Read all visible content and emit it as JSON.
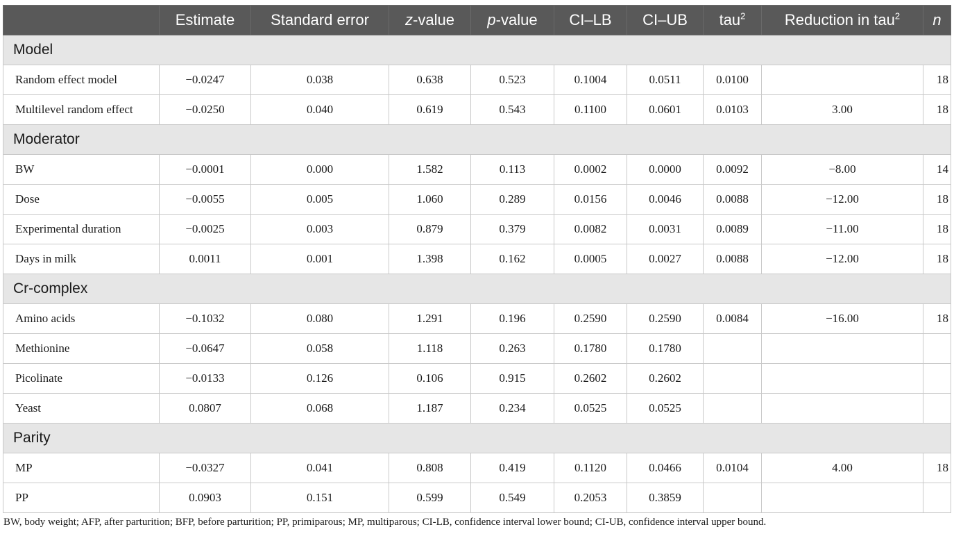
{
  "header": {
    "c1": "Estimate",
    "c2": "Standard error",
    "c3_italic": "z",
    "c3_rest": "-value",
    "c4_italic": "p",
    "c4_rest": "-value",
    "c5": "CI–LB",
    "c6": "CI–UB",
    "c7_base": "tau",
    "c7_sup": "2",
    "c8_base": "Reduction in tau",
    "c8_sup": "2",
    "c9": "n"
  },
  "sections": [
    {
      "title": "Model",
      "rows": [
        {
          "label": "Random effect model",
          "estimate": "−0.0247",
          "se": "0.038",
          "z": "0.638",
          "p": "0.523",
          "cilb": "0.1004",
          "ciub": "0.0511",
          "tau2": "0.0100",
          "reduction": "",
          "n": "18"
        },
        {
          "label": "Multilevel random effect",
          "estimate": "−0.0250",
          "se": "0.040",
          "z": "0.619",
          "p": "0.543",
          "cilb": "0.1100",
          "ciub": "0.0601",
          "tau2": "0.0103",
          "reduction": "3.00",
          "n": "18"
        }
      ]
    },
    {
      "title": "Moderator",
      "rows": [
        {
          "label": "BW",
          "estimate": "−0.0001",
          "se": "0.000",
          "z": "1.582",
          "p": "0.113",
          "cilb": "0.0002",
          "ciub": "0.0000",
          "tau2": "0.0092",
          "reduction": "−8.00",
          "n": "14"
        },
        {
          "label": "Dose",
          "estimate": "−0.0055",
          "se": "0.005",
          "z": "1.060",
          "p": "0.289",
          "cilb": "0.0156",
          "ciub": "0.0046",
          "tau2": "0.0088",
          "reduction": "−12.00",
          "n": "18"
        },
        {
          "label": "Experimental duration",
          "estimate": "−0.0025",
          "se": "0.003",
          "z": "0.879",
          "p": "0.379",
          "cilb": "0.0082",
          "ciub": "0.0031",
          "tau2": "0.0089",
          "reduction": "−11.00",
          "n": "18"
        },
        {
          "label": "Days in milk",
          "estimate": "0.0011",
          "se": "0.001",
          "z": "1.398",
          "p": "0.162",
          "cilb": "0.0005",
          "ciub": "0.0027",
          "tau2": "0.0088",
          "reduction": "−12.00",
          "n": "18"
        }
      ]
    },
    {
      "title": "Cr-complex",
      "rows": [
        {
          "label": "Amino acids",
          "estimate": "−0.1032",
          "se": "0.080",
          "z": "1.291",
          "p": "0.196",
          "cilb": "0.2590",
          "ciub": "0.2590",
          "tau2": "0.0084",
          "reduction": "−16.00",
          "n": "18"
        },
        {
          "label": "Methionine",
          "estimate": "−0.0647",
          "se": "0.058",
          "z": "1.118",
          "p": "0.263",
          "cilb": "0.1780",
          "ciub": "0.1780",
          "tau2": "",
          "reduction": "",
          "n": ""
        },
        {
          "label": "Picolinate",
          "estimate": "−0.0133",
          "se": "0.126",
          "z": "0.106",
          "p": "0.915",
          "cilb": "0.2602",
          "ciub": "0.2602",
          "tau2": "",
          "reduction": "",
          "n": ""
        },
        {
          "label": "Yeast",
          "estimate": "0.0807",
          "se": "0.068",
          "z": "1.187",
          "p": "0.234",
          "cilb": "0.0525",
          "ciub": "0.0525",
          "tau2": "",
          "reduction": "",
          "n": ""
        }
      ]
    },
    {
      "title": "Parity",
      "rows": [
        {
          "label": "MP",
          "estimate": "−0.0327",
          "se": "0.041",
          "z": "0.808",
          "p": "0.419",
          "cilb": "0.1120",
          "ciub": "0.0466",
          "tau2": "0.0104",
          "reduction": "4.00",
          "n": "18"
        },
        {
          "label": "PP",
          "estimate": "0.0903",
          "se": "0.151",
          "z": "0.599",
          "p": "0.549",
          "cilb": "0.2053",
          "ciub": "0.3859",
          "tau2": "",
          "reduction": "",
          "n": ""
        }
      ]
    }
  ],
  "footnote": "BW, body weight; AFP, after parturition; BFP, before parturition; PP, primiparous; MP, multiparous; CI-LB, confidence interval lower bound; CI-UB, confidence interval upper bound.",
  "colors": {
    "header_bg": "#595959",
    "section_bg": "#e6e6e6",
    "border": "#c8c8c8",
    "text": "#1a1a1a"
  }
}
